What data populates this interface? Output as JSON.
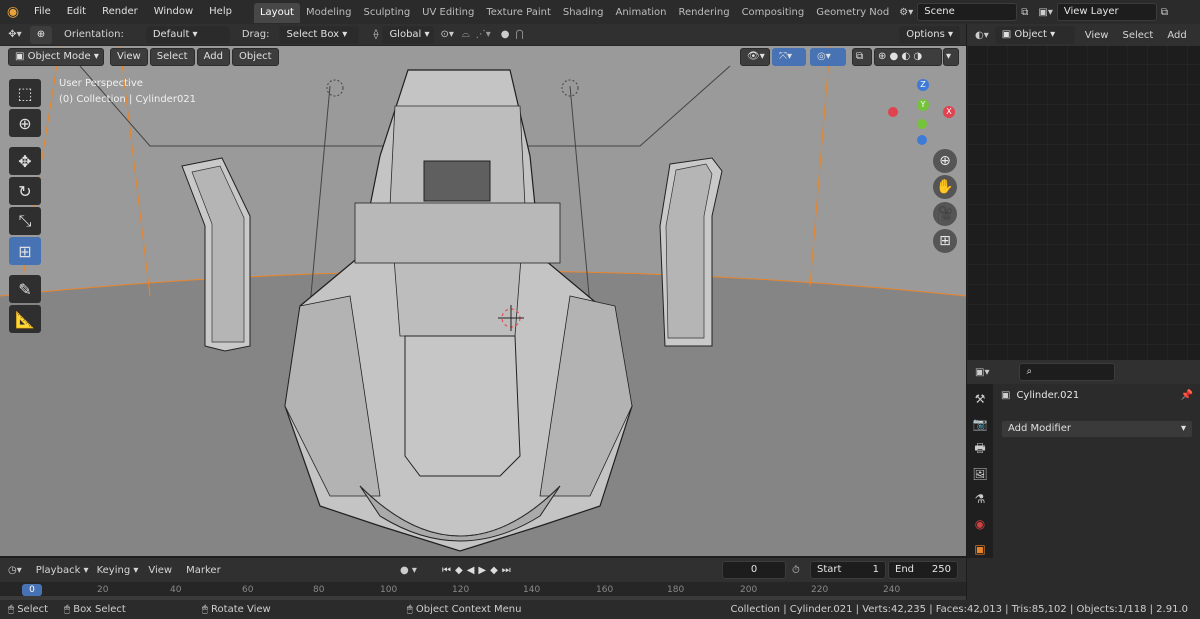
{
  "menu": [
    "File",
    "Edit",
    "Render",
    "Window",
    "Help"
  ],
  "workspaces": [
    "Layout",
    "Modeling",
    "Sculpting",
    "UV Editing",
    "Texture Paint",
    "Shading",
    "Animation",
    "Rendering",
    "Compositing",
    "Geometry Nod"
  ],
  "active_workspace": "Layout",
  "scene": "Scene",
  "view_layer": "View Layer",
  "header": {
    "orientation_label": "Orientation:",
    "orientation_value": "Default",
    "drag_label": "Drag:",
    "drag_value": "Select Box",
    "transform_value": "Global",
    "options_label": "Options"
  },
  "viewport_menu": {
    "mode": "Object Mode",
    "items": [
      "View",
      "Select",
      "Add",
      "Object"
    ]
  },
  "viewport_info": {
    "line1": "User Perspective",
    "line2": "(0) Collection | Cylinder021"
  },
  "gizmo": {
    "z": "Z",
    "y": "Y",
    "x": "X"
  },
  "outliner": {
    "mode": "Object",
    "items": [
      "View",
      "Select",
      "Add"
    ]
  },
  "properties": {
    "object_name": "Cylinder.021",
    "add_modifier": "Add Modifier"
  },
  "timeline": {
    "items": [
      "Playback",
      "Keying",
      "View",
      "Marker"
    ],
    "current_frame": "0",
    "start_label": "Start",
    "start_value": "1",
    "end_label": "End",
    "end_value": "250",
    "ruler": [
      "0",
      "20",
      "40",
      "60",
      "80",
      "100",
      "120",
      "140",
      "160",
      "180",
      "200",
      "220",
      "240"
    ]
  },
  "statusbar": {
    "select": "Select",
    "box_select": "Box Select",
    "rotate_view": "Rotate View",
    "context_menu": "Object Context Menu",
    "stats": "Collection | Cylinder.021 | Verts:42,235 | Faces:42,013 | Tris:85,102 | Objects:1/118 | 2.91.0"
  },
  "colors": {
    "accent": "#4772b3",
    "viewport_bg": "#8e8e8e",
    "axis_x": "#e0424f",
    "axis_y": "#74c33a",
    "axis_z": "#3f7bd6",
    "selection_orange": "#e8852a"
  }
}
